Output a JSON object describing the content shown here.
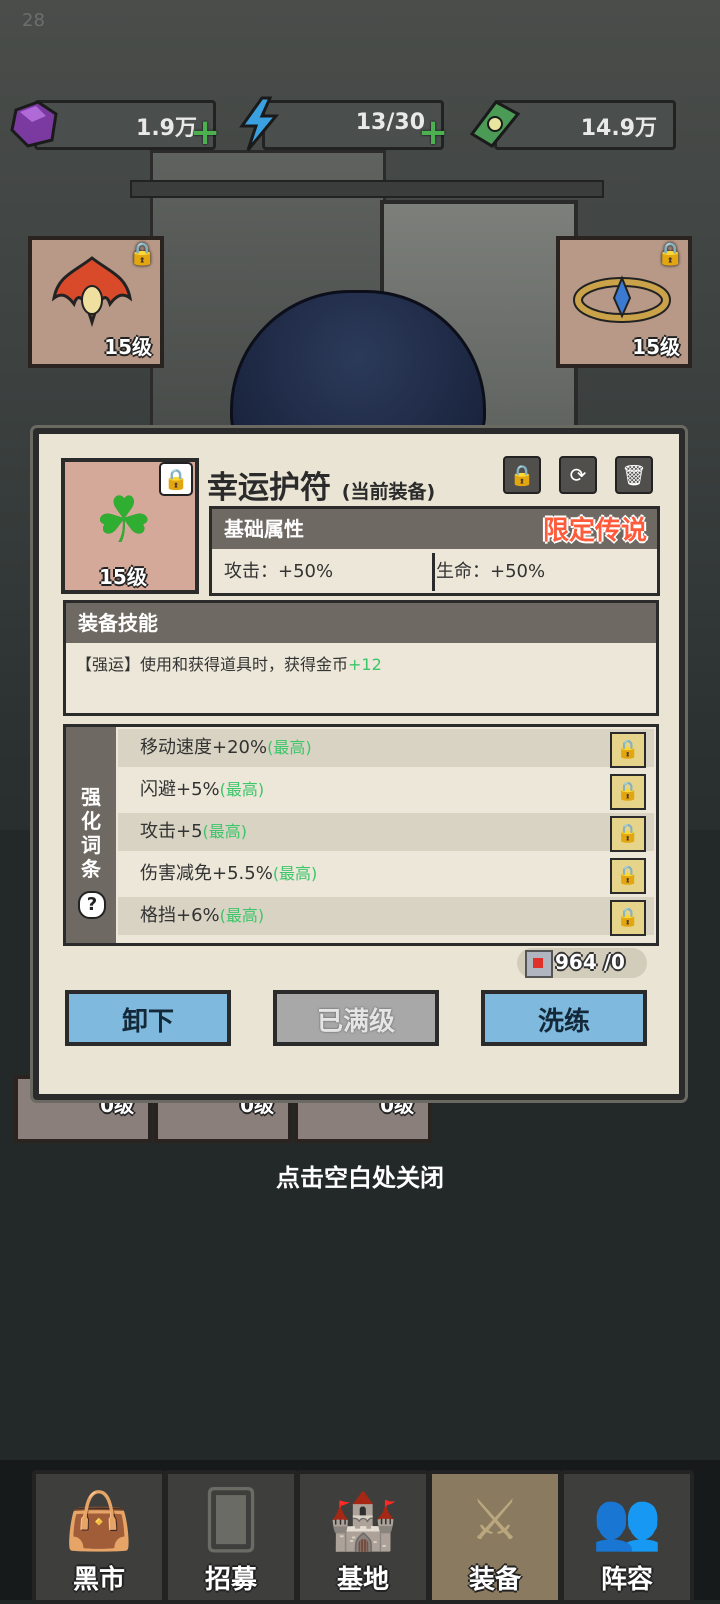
{
  "status": {
    "time_fragment": "28"
  },
  "resources": [
    {
      "icon": "gem-icon",
      "value": "1.9万"
    },
    {
      "icon": "energy-icon",
      "value": "13/30"
    },
    {
      "icon": "cash-icon",
      "value": "14.9万"
    }
  ],
  "slots_top": [
    {
      "level": "15级"
    },
    {
      "level": "15级"
    }
  ],
  "item": {
    "name": "幸运护符",
    "status": "(当前装备)",
    "level": "15级"
  },
  "base": {
    "header": "基础属性",
    "rarity": "限定传说",
    "attack": "攻击：+50%",
    "hp": "生命：+50%"
  },
  "skill": {
    "header": "装备技能",
    "text_main": "【强运】使用和获得道具时，获得金币",
    "text_value": "+12"
  },
  "affixes": {
    "side_label": [
      "强",
      "化",
      "词",
      "条"
    ],
    "help": "?",
    "rows": [
      {
        "text": "移动速度+20%",
        "max": "(最高)"
      },
      {
        "text": "闪避+5%",
        "max": "(最高)"
      },
      {
        "text": "攻击+5",
        "max": "(最高)"
      },
      {
        "text": "伤害减免+5.5%",
        "max": "(最高)"
      },
      {
        "text": "格挡+6%",
        "max": "(最高)"
      }
    ]
  },
  "cube": {
    "text": "964 /0"
  },
  "buttons": {
    "unequip": "卸下",
    "maxed": "已满级",
    "reroll": "洗练"
  },
  "slots_low": [
    {
      "level": "0级"
    },
    {
      "level": "0级"
    },
    {
      "level": "0级"
    }
  ],
  "close_hint": "点击空白处关闭",
  "nav": [
    {
      "label": "黑市",
      "icon": "bag-icon"
    },
    {
      "label": "招募",
      "icon": "cards-icon"
    },
    {
      "label": "基地",
      "icon": "fort-icon"
    },
    {
      "label": "装备",
      "icon": "equip-icon"
    },
    {
      "label": "阵容",
      "icon": "team-icon"
    }
  ],
  "colors": {
    "legend_orange": "#ff5a3a",
    "max_green": "#3cc66a",
    "button_blue": "#7fb9dd",
    "plus_green": "#4caf50"
  }
}
